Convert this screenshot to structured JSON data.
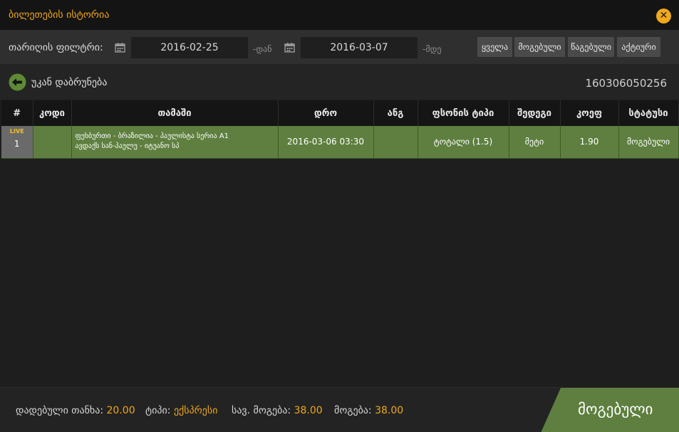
{
  "window": {
    "title": "ბილეთების ისტორია",
    "close_label": "✕"
  },
  "filter": {
    "label": "თარიღის ფილტრი:",
    "date_from": "2016-02-25",
    "from_suffix": "-დან",
    "date_to": "2016-03-07",
    "to_suffix": "-მდე",
    "buttons": [
      "ყველა",
      "მოგებული",
      "წაგებული",
      "აქტიური"
    ]
  },
  "nav": {
    "back_label": "უკან დაბრუნება",
    "ticket_id": "160306050256"
  },
  "table": {
    "headers": [
      "#",
      "კოდი",
      "თამაში",
      "დრო",
      "ანგ",
      "ფსონის ტიპი",
      "შედეგი",
      "კოეფ",
      "სტატუსი"
    ],
    "rows": [
      {
        "live_badge": "LIVE",
        "number": "1",
        "code": "",
        "game_line1": "ფეხბურთი - ბრაზილია - პაულისტა სერია A1",
        "game_line2": "ავდაქს სან-პაულუ - იტუანო სპ",
        "time": "2016-03-06 03:30",
        "score": "",
        "bet_type": "ტოტალი (1.5)",
        "result": "მეტი",
        "odds": "1.90",
        "status": "მოგებული"
      }
    ]
  },
  "footer": {
    "stake_label": "დადებული თანხა:",
    "stake_value": "20.00",
    "type_label": "ტიპი:",
    "type_value": "ექსპრესი",
    "potential_label": "სავ. მოგება:",
    "potential_value": "38.00",
    "win_label": "მოგება:",
    "win_value": "38.00",
    "status_label": "მოგებული"
  },
  "colors": {
    "accent": "#f0a81c",
    "win_green": "#5e7f3f",
    "background": "#1e1e1e"
  },
  "icons": {
    "close": "close-icon",
    "calendar": "calendar-icon",
    "back": "back-arrow-icon"
  }
}
